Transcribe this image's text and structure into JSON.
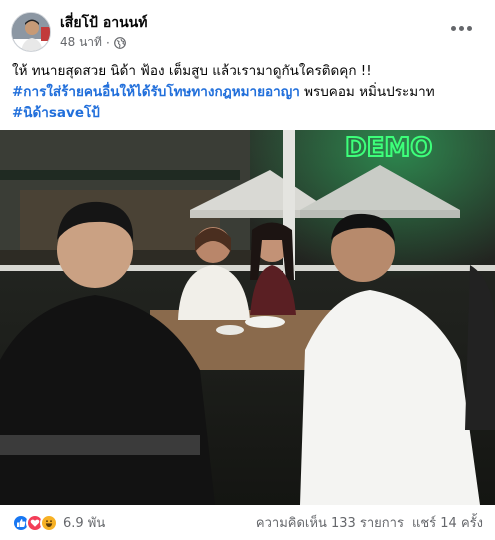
{
  "post": {
    "author": "เสี่ยโป้ อานนท์",
    "time": "48 นาที",
    "dot": "·",
    "caption": {
      "line1": "ให้ ทนายสุดสวย นิด้า ฟ้อง เต็มสูบ แล้วเรามาดูกันใครติดคุก !!",
      "hashtag1": "#การใส่ร้ายคนอื่นให้ได้รับโทษทางกฎหมายอาญา",
      "line2_rest": " พรบคอม หมิ่นประมาท",
      "hashtag2": "#นิด้าsaveโป้"
    },
    "photo_sign": "DEMO"
  },
  "footer": {
    "reaction_count": "6.9 พัน",
    "comments": "ความคิดเห็น 133 รายการ",
    "shares": "แชร์ 14 ครั้ง"
  },
  "icons": {
    "more": "more-options-icon",
    "globe": "globe-icon",
    "like": "like-reaction-icon",
    "love": "love-reaction-icon",
    "haha": "haha-reaction-icon"
  },
  "colors": {
    "hashtag": "#216fdb",
    "secondary_text": "#65676b",
    "like": "#1877f2",
    "love": "#f33e58",
    "haha": "#f7b125",
    "neon": "#3dff7a"
  }
}
